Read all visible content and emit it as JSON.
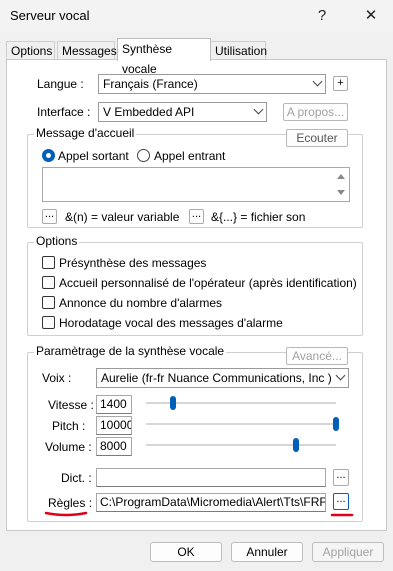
{
  "window": {
    "title": "Serveur vocal",
    "help": "?",
    "close": "✕"
  },
  "tabs": [
    "Options",
    "Messages",
    "Synthèse vocale",
    "Utilisation"
  ],
  "langue": {
    "label": "Langue :",
    "value": "Français (France)",
    "add": "+"
  },
  "interface": {
    "label": "Interface :",
    "value": "V Embedded API",
    "apropos": "A propos..."
  },
  "accueil": {
    "title": "Message d'accueil",
    "ecouter": "Ecouter",
    "radio_out": "Appel sortant",
    "radio_in": "Appel entrant",
    "ellipsis": "...",
    "var_hint": "&(n) = valeur variable",
    "file_hint": "&{...} = fichier son"
  },
  "options": {
    "title": "Options",
    "items": [
      "Présynthèse des messages",
      "Accueil personnalisé de l'opérateur (après identification)",
      "Annonce du nombre d'alarmes",
      "Horodatage vocal des messages d'alarme"
    ]
  },
  "synth": {
    "title": "Paramètrage de la synthèse vocale",
    "avance": "Avancé...",
    "voix_label": "Voix :",
    "voix_value": "Aurelie (fr-fr Nuance Communications, Inc )",
    "vitesse_label": "Vitesse :",
    "vitesse_value": "1400",
    "pitch_label": "Pitch :",
    "pitch_value": "10000",
    "volume_label": "Volume :",
    "volume_value": "8000",
    "dict_label": "Dict. :",
    "dict_value": "",
    "regles_label": "Règles :",
    "regles_value": "C:\\ProgramData\\Micromedia\\Alert\\Tts\\FRF-Rul",
    "browse": "..."
  },
  "sliders": {
    "vitesse": 0.14,
    "pitch": 1.0,
    "volume": 0.79
  },
  "footer": {
    "ok": "OK",
    "cancel": "Annuler",
    "apply": "Appliquer"
  },
  "colors": {
    "accent": "#005fb8",
    "annotation": "#e0001b"
  }
}
